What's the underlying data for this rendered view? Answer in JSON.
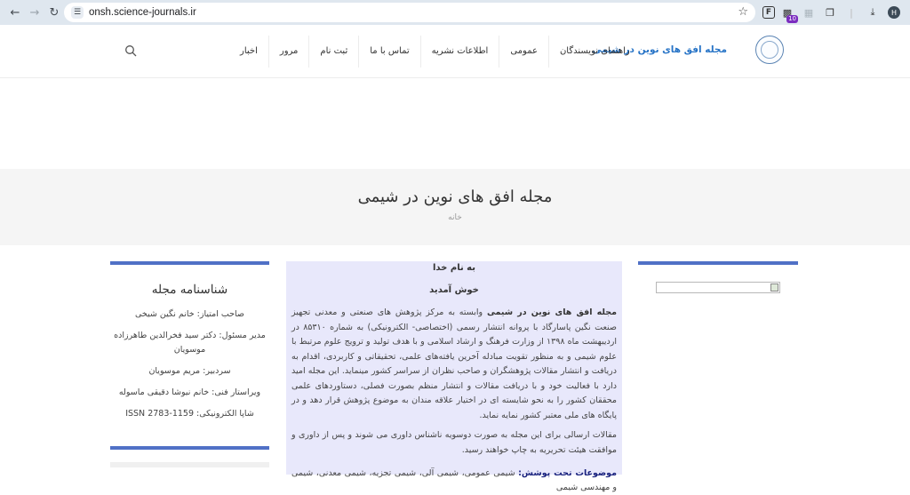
{
  "browser": {
    "url": "onsh.science-journals.ir",
    "profile_initial": "H",
    "ext_badge": "10",
    "ext_label": "F"
  },
  "site": {
    "title": "مجله افق های نوین در شیمی",
    "nav": [
      "راهنمای نویسندگان",
      "عمومی",
      "اطلاعات نشریه",
      "تماس با ما",
      "ثبت نام",
      "مرور",
      "اخبار"
    ]
  },
  "hero": {
    "title": "مجله افق های نوین در شیمی",
    "breadcrumb": "خانه"
  },
  "sidebar": {
    "heading": "شناسنامه مجله",
    "items": [
      "صاحب امتیاز: خانم نگین شیخی",
      "مدیر مسئول: دکتر سید فخرالدین طاهرزاده موسویان",
      "سردبیر: مریم موسویان",
      "ویراستار فنی: خانم نیوشا دقیقی ماسوله",
      "شاپا الکترونیکی: 1159-2783 ISSN"
    ]
  },
  "main": {
    "basmala": "به نام خدا",
    "welcome": "خوش آمدید",
    "intro_bold": "مجله افق های نوین در شیمی",
    "intro_text": "  وابسته به مرکز پژوهش های صنعتی و معدنی تجهیز صنعت نگین پاسارگاد با پروانه انتشار رسمی (اختصاصی- الکترونیکی) به شماره ۸۵۳۱۰ در اردیبهشت ماه ۱۳۹۸ از وزارت فرهنگ و ارشاد اسلامی و با هدف تولید و ترویج علوم مرتبط با علوم شیمی و به منظور تقویت مبادله آخرین یافته‌های علمی، تحقیقاتی و کاربردی، اقدام به دریافت و انتشار مقالات پژوهشگران و صاحب نظران از سراسر کشور مینماید. این مجله امید دارد با فعالیت خود و با دریافت مقالات و انتشار منظم بصورت فصلی، دستاوردهای علمی  محققان کشور را به نحو شایسته ای در اختیار علاقه مندان به موضوع پژوهش قرار دهد و در پایگاه های ملی معتبر کشور نمایه نماید.",
    "review_text": "مقالات ارسالی برای این مجله به صورت دوسویه ناشناس داوری می شوند و پس از داوری و موافقت هیئت تحریریه به چاپ خواهند رسید.",
    "topics_label": "موضوعات تحت پوشش:",
    "topics_text": " شیمی عمومی، شیمی آلی، شیمی تجزیه، شیمی معدنی، شیمی و مهندسی شیمی"
  }
}
